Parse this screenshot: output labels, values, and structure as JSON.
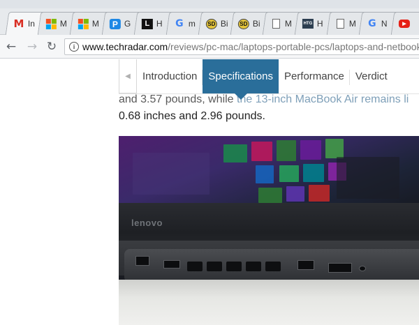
{
  "tabs": [
    {
      "favicon": "gmail-icon",
      "label": "In"
    },
    {
      "favicon": "microsoft-icon",
      "label": "M"
    },
    {
      "favicon": "microsoft-icon",
      "label": "M"
    },
    {
      "favicon": "p-icon",
      "label": "G"
    },
    {
      "favicon": "l-icon",
      "label": "H"
    },
    {
      "favicon": "google-icon",
      "label": "m"
    },
    {
      "favicon": "sd-icon",
      "label": "Bi"
    },
    {
      "favicon": "sd-icon",
      "label": "Bi"
    },
    {
      "favicon": "document-icon",
      "label": "M"
    },
    {
      "favicon": "htg-icon",
      "label": "H"
    },
    {
      "favicon": "document-icon",
      "label": "M"
    },
    {
      "favicon": "google-icon",
      "label": "N"
    },
    {
      "favicon": "youtube-icon",
      "label": ""
    }
  ],
  "favicon_text": {
    "gmail": "M",
    "p": "P",
    "l": "L",
    "google": "G",
    "sd": "SD",
    "htg": "HTG",
    "youtube": "▶"
  },
  "toolbar": {
    "back": "←",
    "forward": "→",
    "reload": "↻",
    "info": "i",
    "url_host": "www.techradar.com",
    "url_path": "/reviews/pc-mac/laptops-portable-pcs/laptops-and-netbooks"
  },
  "subnav": {
    "prev_arrow": "◀",
    "items": [
      "Introduction",
      "Specifications",
      "Performance",
      "Verdict"
    ],
    "active_index": 1
  },
  "article": {
    "line1_start": "and 3.57 pounds, while ",
    "line1_link": "the 13-inch MacBook Air remains li",
    "line2": "0.68 inches and 2.96 pounds."
  },
  "photo": {
    "brand_text": "lenovo"
  },
  "colors": {
    "subnav_active": "#2a6e9a",
    "link": "#7e9fb8",
    "tabstrip": "#e7eaed"
  }
}
